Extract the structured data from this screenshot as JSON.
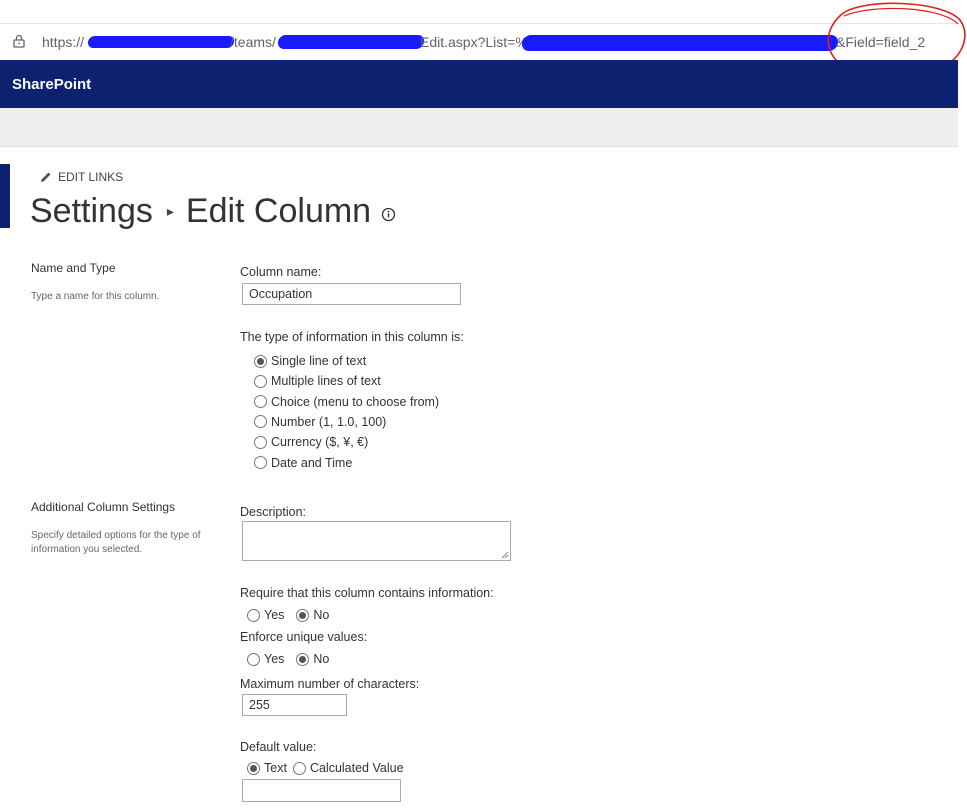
{
  "browser": {
    "url_prefix": "https://",
    "url_teams": "/teams/",
    "url_edit": "Edit.aspx?List=%7",
    "url_field": "&Field=field_2"
  },
  "suite": {
    "brand": "SharePoint"
  },
  "page": {
    "edit_links": "EDIT LINKS",
    "breadcrumb_root": "Settings",
    "breadcrumb_sep": "▸",
    "title": "Edit Column"
  },
  "name_type": {
    "section_title": "Name and Type",
    "section_desc": "Type a name for this column.",
    "column_name_label": "Column name:",
    "column_name_value": "Occupation",
    "type_label": "The type of information in this column is:",
    "types": [
      {
        "label": "Single line of text",
        "selected": true
      },
      {
        "label": "Multiple lines of text",
        "selected": false
      },
      {
        "label": "Choice (menu to choose from)",
        "selected": false
      },
      {
        "label": "Number (1, 1.0, 100)",
        "selected": false
      },
      {
        "label": "Currency ($, ¥, €)",
        "selected": false
      },
      {
        "label": "Date and Time",
        "selected": false
      }
    ]
  },
  "additional": {
    "section_title": "Additional Column Settings",
    "section_desc": "Specify detailed options for the type of information you selected.",
    "description_label": "Description:",
    "require_label": "Require that this column contains information:",
    "require_yes": "Yes",
    "require_no": "No",
    "unique_label": "Enforce unique values:",
    "unique_yes": "Yes",
    "unique_no": "No",
    "maxchars_label": "Maximum number of characters:",
    "maxchars_value": "255",
    "default_label": "Default value:",
    "default_text": "Text",
    "default_calc": "Calculated Value",
    "default_value": ""
  },
  "colors": {
    "suite_bar": "#0c2170",
    "redaction": "#1a1aff",
    "annotation": "#e0201c"
  }
}
